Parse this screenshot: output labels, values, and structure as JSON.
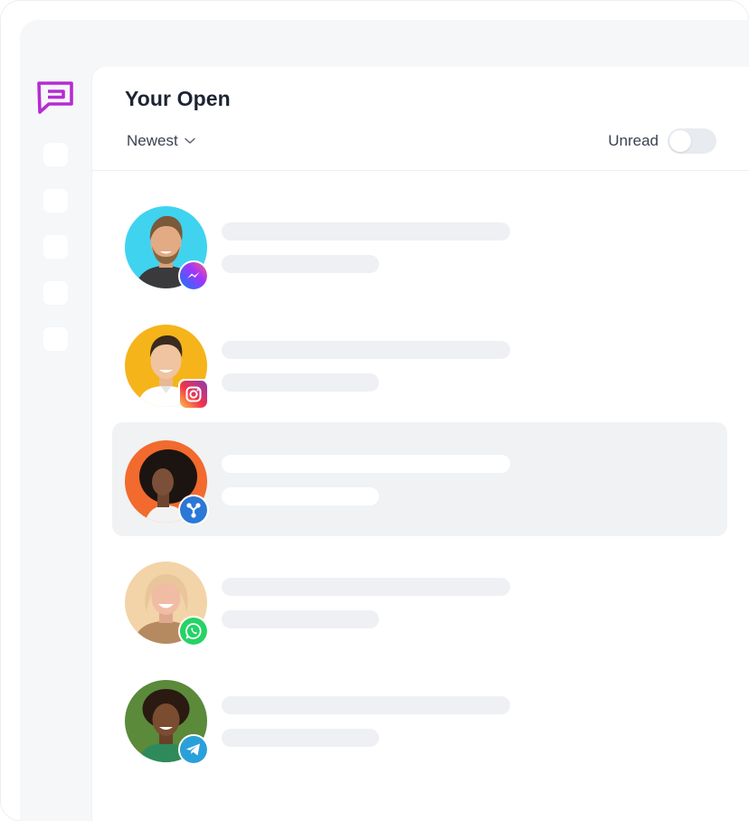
{
  "app": {
    "logo_icon": "chat-bubble-logo-icon",
    "brand_color": "#b62bd4"
  },
  "sidebar": {
    "items": [
      {
        "name": "nav-item-1"
      },
      {
        "name": "nav-item-2"
      },
      {
        "name": "nav-item-3"
      },
      {
        "name": "nav-item-4"
      },
      {
        "name": "nav-item-5"
      }
    ]
  },
  "inbox": {
    "title": "Your Open",
    "sort_label": "Newest",
    "unread_label": "Unread",
    "unread_enabled": false
  },
  "conversations": [
    {
      "avatar_bg": "#3fd3f0",
      "channel": "messenger",
      "channel_icon": "messenger-icon",
      "active": false
    },
    {
      "avatar_bg": "#f5b41a",
      "channel": "instagram",
      "channel_icon": "instagram-icon",
      "active": false
    },
    {
      "avatar_bg": "#f26a2e",
      "channel": "custom-channel",
      "channel_icon": "connect-icon",
      "active": true
    },
    {
      "avatar_bg": "#f2d4a8",
      "channel": "whatsapp",
      "channel_icon": "whatsapp-icon",
      "active": false
    },
    {
      "avatar_bg": "#5a8a3a",
      "channel": "telegram",
      "channel_icon": "telegram-icon",
      "active": false
    }
  ]
}
